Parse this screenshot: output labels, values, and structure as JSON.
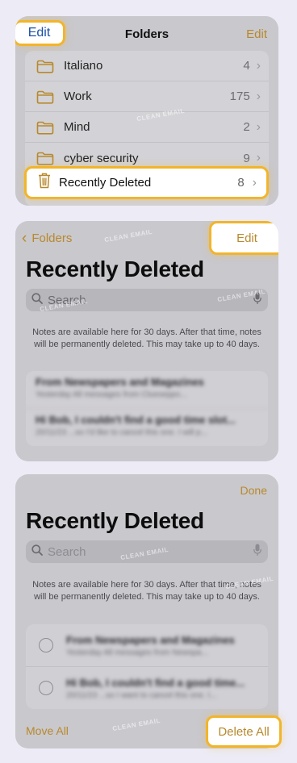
{
  "panel1": {
    "edit_left": "Edit",
    "title": "Folders",
    "edit_right": "Edit",
    "folders": [
      {
        "name": "Italiano",
        "count": "4"
      },
      {
        "name": "Work",
        "count": "175"
      },
      {
        "name": "Mind",
        "count": "2"
      },
      {
        "name": "cyber security",
        "count": "9"
      }
    ],
    "recently_deleted": {
      "name": "Recently Deleted",
      "count": "8"
    }
  },
  "panel2": {
    "back_label": "Folders",
    "edit_label": "Edit",
    "title": "Recently Deleted",
    "search_placeholder": "Search",
    "info": "Notes are available here for 30 days. After that time, notes will be permanently deleted. This may take up to 40 days.",
    "notes": [
      {
        "title": "From Newspapers and Magazines",
        "subtitle": "Yesterday  All messages from Clueseppo..."
      },
      {
        "title": "Hi Bob, I couldn't find a good time slot...",
        "subtitle": "20/11/23  ...so I'd like to cancel this one. I will p..."
      }
    ]
  },
  "panel3": {
    "done_label": "Done",
    "title": "Recently Deleted",
    "search_placeholder": "Search",
    "info": "Notes are available here for 30 days. After that time, notes will be permanently deleted. This may take up to 40 days.",
    "notes": [
      {
        "title": "From Newspapers and Magazines",
        "subtitle": "Yesterday  All messages from Newspa..."
      },
      {
        "title": "Hi Bob, I couldn't find a good time...",
        "subtitle": "20/11/23  ...so I want to cancel this one. I..."
      }
    ],
    "move_all_label": "Move All",
    "delete_all_label": "Delete All"
  },
  "watermark": "CLEAN EMAIL",
  "colors": {
    "accent": "#b8892c",
    "highlight": "#f2b52a",
    "edit_blue": "#1b4fa6"
  }
}
